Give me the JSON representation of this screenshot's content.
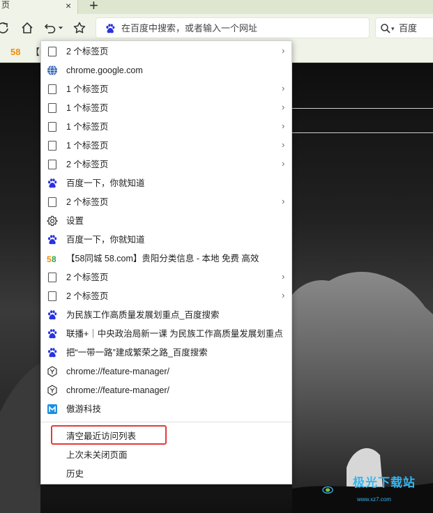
{
  "tabstrip": {
    "tab_fragment": "页",
    "close_glyph": "×",
    "new_tab_glyph": "+"
  },
  "omnibox": {
    "placeholder": "在百度中搜索，或者输入一个网址"
  },
  "search": {
    "engine": "百度",
    "caret": "▾"
  },
  "bookmarks": {
    "item_58": "58",
    "item_fragment": "【5"
  },
  "menu": {
    "arrow": "›",
    "items": [
      {
        "icon": "page-icon",
        "label": "2 个标签页",
        "submenu": true
      },
      {
        "icon": "globe-icon",
        "label": "chrome.google.com",
        "submenu": false
      },
      {
        "icon": "page-icon",
        "label": "1 个标签页",
        "submenu": true
      },
      {
        "icon": "page-icon",
        "label": "1 个标签页",
        "submenu": true
      },
      {
        "icon": "page-icon",
        "label": "1 个标签页",
        "submenu": true
      },
      {
        "icon": "page-icon",
        "label": "1 个标签页",
        "submenu": true
      },
      {
        "icon": "page-icon",
        "label": "2 个标签页",
        "submenu": true
      },
      {
        "icon": "baidu-paw-icon",
        "label": "百度一下，你就知道",
        "submenu": false
      },
      {
        "icon": "page-icon",
        "label": "2 个标签页",
        "submenu": true
      },
      {
        "icon": "gear-icon",
        "label": "设置",
        "submenu": false
      },
      {
        "icon": "baidu-paw-icon",
        "label": "百度一下，你就知道",
        "submenu": false
      },
      {
        "icon": "58-logo-icon",
        "label": "【58同城 58.com】贵阳分类信息 - 本地 免费 高效",
        "submenu": false
      },
      {
        "icon": "page-icon",
        "label": "2 个标签页",
        "submenu": true
      },
      {
        "icon": "page-icon",
        "label": "2 个标签页",
        "submenu": true
      },
      {
        "icon": "baidu-paw-icon",
        "label": "为民族工作高质量发展划重点_百度搜索",
        "submenu": false
      },
      {
        "icon": "baidu-paw-icon",
        "label": "联播+｜中央政治局新一课 为民族工作高质量发展划重点",
        "submenu": false
      },
      {
        "icon": "baidu-paw-icon",
        "label": "把“一带一路”建成繁荣之路_百度搜索",
        "submenu": false
      },
      {
        "icon": "hexagon-y-icon",
        "label": "chrome://feature-manager/",
        "submenu": false
      },
      {
        "icon": "hexagon-y-icon",
        "label": "chrome://feature-manager/",
        "submenu": false
      },
      {
        "icon": "maxthon-icon",
        "label": "傲游科技",
        "submenu": false
      }
    ],
    "clear_recent": "清空最近访问列表",
    "last_closed": "上次未关闭页面",
    "history": "历史"
  },
  "watermark": {
    "title": "极光下载站",
    "url": "www.xz7.com"
  },
  "colors": {
    "toolbar_bg": "#f0f3e8",
    "baidu_blue": "#2932e1",
    "highlight_red": "#e23a3a",
    "maxthon_blue": "#1a8fe3"
  }
}
